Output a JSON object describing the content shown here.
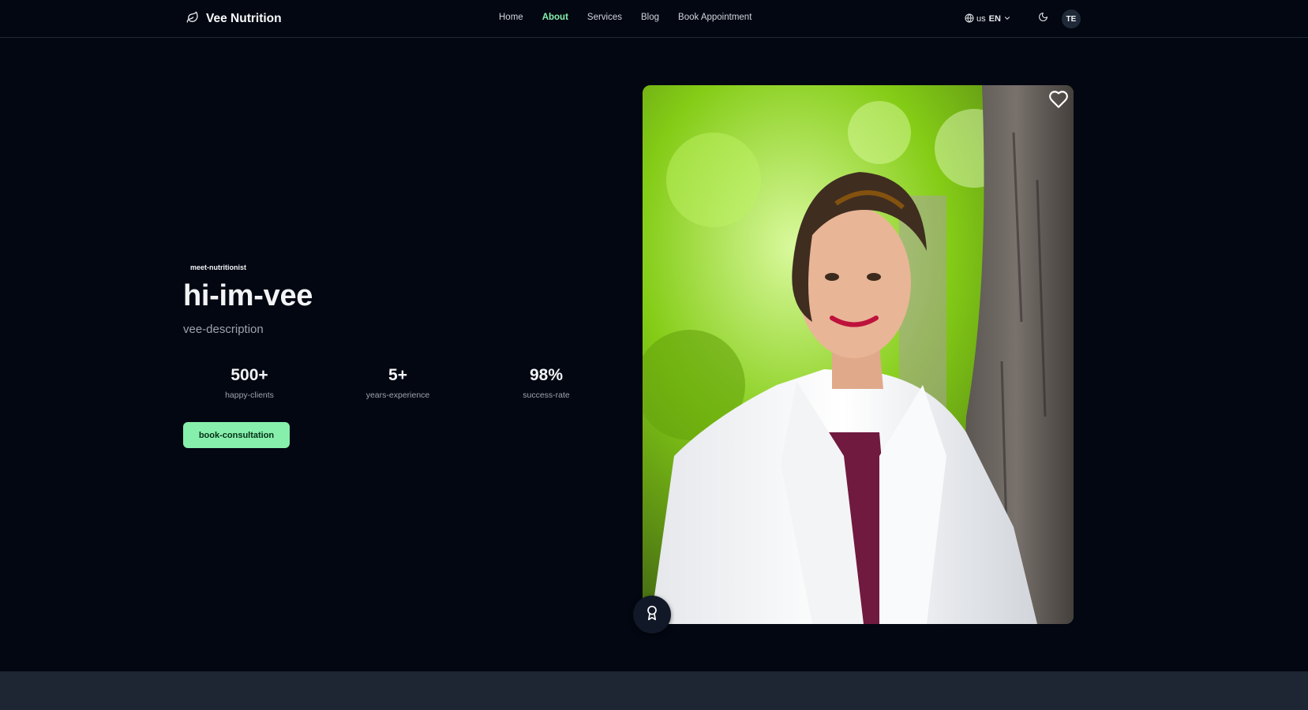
{
  "nav": {
    "brand": "Vee Nutrition",
    "links": [
      {
        "label": "Home",
        "active": false
      },
      {
        "label": "About",
        "active": true
      },
      {
        "label": "Services",
        "active": false
      },
      {
        "label": "Blog",
        "active": false
      },
      {
        "label": "Book Appointment",
        "active": false
      }
    ],
    "language": {
      "flag": "us",
      "code": "EN"
    },
    "avatar_initials": "TE"
  },
  "hero": {
    "eyebrow": "meet-nutritionist",
    "title": "hi-im-vee",
    "description": "vee-description",
    "stats": [
      {
        "value": "500+",
        "label": "happy-clients"
      },
      {
        "value": "5+",
        "label": "years-experience"
      },
      {
        "value": "98%",
        "label": "success-rate"
      }
    ],
    "cta_label": "book-consultation"
  },
  "icons": {
    "logo": "leaf-icon",
    "language": "globe-icon",
    "theme": "moon-icon",
    "favorite": "heart-icon",
    "badge": "award-icon"
  },
  "colors": {
    "background": "#030712",
    "accent": "#86efac",
    "muted_text": "#9ca3af",
    "footer_band": "#1e2533"
  }
}
